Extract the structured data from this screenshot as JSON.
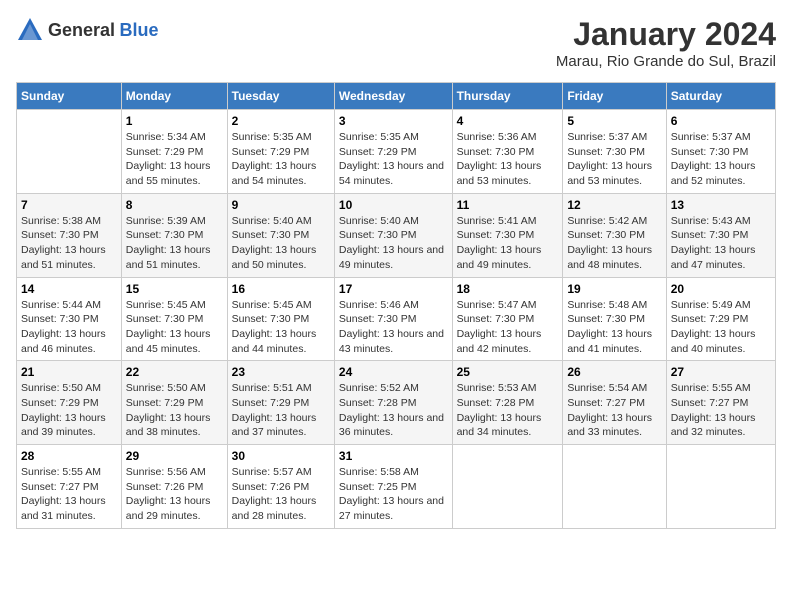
{
  "logo": {
    "text_general": "General",
    "text_blue": "Blue"
  },
  "header": {
    "title": "January 2024",
    "subtitle": "Marau, Rio Grande do Sul, Brazil"
  },
  "weekdays": [
    "Sunday",
    "Monday",
    "Tuesday",
    "Wednesday",
    "Thursday",
    "Friday",
    "Saturday"
  ],
  "weeks": [
    [
      {
        "day": "",
        "sunrise": "",
        "sunset": "",
        "daylight": ""
      },
      {
        "day": "1",
        "sunrise": "Sunrise: 5:34 AM",
        "sunset": "Sunset: 7:29 PM",
        "daylight": "Daylight: 13 hours and 55 minutes."
      },
      {
        "day": "2",
        "sunrise": "Sunrise: 5:35 AM",
        "sunset": "Sunset: 7:29 PM",
        "daylight": "Daylight: 13 hours and 54 minutes."
      },
      {
        "day": "3",
        "sunrise": "Sunrise: 5:35 AM",
        "sunset": "Sunset: 7:29 PM",
        "daylight": "Daylight: 13 hours and 54 minutes."
      },
      {
        "day": "4",
        "sunrise": "Sunrise: 5:36 AM",
        "sunset": "Sunset: 7:30 PM",
        "daylight": "Daylight: 13 hours and 53 minutes."
      },
      {
        "day": "5",
        "sunrise": "Sunrise: 5:37 AM",
        "sunset": "Sunset: 7:30 PM",
        "daylight": "Daylight: 13 hours and 53 minutes."
      },
      {
        "day": "6",
        "sunrise": "Sunrise: 5:37 AM",
        "sunset": "Sunset: 7:30 PM",
        "daylight": "Daylight: 13 hours and 52 minutes."
      }
    ],
    [
      {
        "day": "7",
        "sunrise": "Sunrise: 5:38 AM",
        "sunset": "Sunset: 7:30 PM",
        "daylight": "Daylight: 13 hours and 51 minutes."
      },
      {
        "day": "8",
        "sunrise": "Sunrise: 5:39 AM",
        "sunset": "Sunset: 7:30 PM",
        "daylight": "Daylight: 13 hours and 51 minutes."
      },
      {
        "day": "9",
        "sunrise": "Sunrise: 5:40 AM",
        "sunset": "Sunset: 7:30 PM",
        "daylight": "Daylight: 13 hours and 50 minutes."
      },
      {
        "day": "10",
        "sunrise": "Sunrise: 5:40 AM",
        "sunset": "Sunset: 7:30 PM",
        "daylight": "Daylight: 13 hours and 49 minutes."
      },
      {
        "day": "11",
        "sunrise": "Sunrise: 5:41 AM",
        "sunset": "Sunset: 7:30 PM",
        "daylight": "Daylight: 13 hours and 49 minutes."
      },
      {
        "day": "12",
        "sunrise": "Sunrise: 5:42 AM",
        "sunset": "Sunset: 7:30 PM",
        "daylight": "Daylight: 13 hours and 48 minutes."
      },
      {
        "day": "13",
        "sunrise": "Sunrise: 5:43 AM",
        "sunset": "Sunset: 7:30 PM",
        "daylight": "Daylight: 13 hours and 47 minutes."
      }
    ],
    [
      {
        "day": "14",
        "sunrise": "Sunrise: 5:44 AM",
        "sunset": "Sunset: 7:30 PM",
        "daylight": "Daylight: 13 hours and 46 minutes."
      },
      {
        "day": "15",
        "sunrise": "Sunrise: 5:45 AM",
        "sunset": "Sunset: 7:30 PM",
        "daylight": "Daylight: 13 hours and 45 minutes."
      },
      {
        "day": "16",
        "sunrise": "Sunrise: 5:45 AM",
        "sunset": "Sunset: 7:30 PM",
        "daylight": "Daylight: 13 hours and 44 minutes."
      },
      {
        "day": "17",
        "sunrise": "Sunrise: 5:46 AM",
        "sunset": "Sunset: 7:30 PM",
        "daylight": "Daylight: 13 hours and 43 minutes."
      },
      {
        "day": "18",
        "sunrise": "Sunrise: 5:47 AM",
        "sunset": "Sunset: 7:30 PM",
        "daylight": "Daylight: 13 hours and 42 minutes."
      },
      {
        "day": "19",
        "sunrise": "Sunrise: 5:48 AM",
        "sunset": "Sunset: 7:30 PM",
        "daylight": "Daylight: 13 hours and 41 minutes."
      },
      {
        "day": "20",
        "sunrise": "Sunrise: 5:49 AM",
        "sunset": "Sunset: 7:29 PM",
        "daylight": "Daylight: 13 hours and 40 minutes."
      }
    ],
    [
      {
        "day": "21",
        "sunrise": "Sunrise: 5:50 AM",
        "sunset": "Sunset: 7:29 PM",
        "daylight": "Daylight: 13 hours and 39 minutes."
      },
      {
        "day": "22",
        "sunrise": "Sunrise: 5:50 AM",
        "sunset": "Sunset: 7:29 PM",
        "daylight": "Daylight: 13 hours and 38 minutes."
      },
      {
        "day": "23",
        "sunrise": "Sunrise: 5:51 AM",
        "sunset": "Sunset: 7:29 PM",
        "daylight": "Daylight: 13 hours and 37 minutes."
      },
      {
        "day": "24",
        "sunrise": "Sunrise: 5:52 AM",
        "sunset": "Sunset: 7:28 PM",
        "daylight": "Daylight: 13 hours and 36 minutes."
      },
      {
        "day": "25",
        "sunrise": "Sunrise: 5:53 AM",
        "sunset": "Sunset: 7:28 PM",
        "daylight": "Daylight: 13 hours and 34 minutes."
      },
      {
        "day": "26",
        "sunrise": "Sunrise: 5:54 AM",
        "sunset": "Sunset: 7:27 PM",
        "daylight": "Daylight: 13 hours and 33 minutes."
      },
      {
        "day": "27",
        "sunrise": "Sunrise: 5:55 AM",
        "sunset": "Sunset: 7:27 PM",
        "daylight": "Daylight: 13 hours and 32 minutes."
      }
    ],
    [
      {
        "day": "28",
        "sunrise": "Sunrise: 5:55 AM",
        "sunset": "Sunset: 7:27 PM",
        "daylight": "Daylight: 13 hours and 31 minutes."
      },
      {
        "day": "29",
        "sunrise": "Sunrise: 5:56 AM",
        "sunset": "Sunset: 7:26 PM",
        "daylight": "Daylight: 13 hours and 29 minutes."
      },
      {
        "day": "30",
        "sunrise": "Sunrise: 5:57 AM",
        "sunset": "Sunset: 7:26 PM",
        "daylight": "Daylight: 13 hours and 28 minutes."
      },
      {
        "day": "31",
        "sunrise": "Sunrise: 5:58 AM",
        "sunset": "Sunset: 7:25 PM",
        "daylight": "Daylight: 13 hours and 27 minutes."
      },
      {
        "day": "",
        "sunrise": "",
        "sunset": "",
        "daylight": ""
      },
      {
        "day": "",
        "sunrise": "",
        "sunset": "",
        "daylight": ""
      },
      {
        "day": "",
        "sunrise": "",
        "sunset": "",
        "daylight": ""
      }
    ]
  ]
}
